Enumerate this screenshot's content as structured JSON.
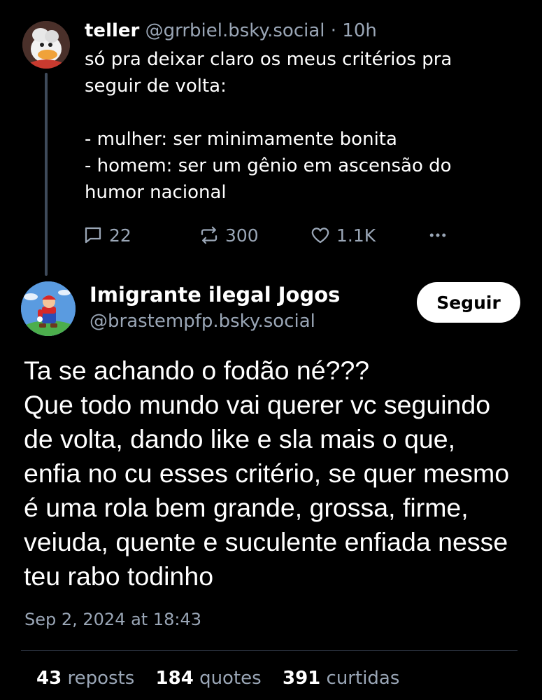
{
  "parent_post": {
    "display_name": "teller",
    "handle": "@grrbiel.bsky.social",
    "separator": "·",
    "time_ago": "10h",
    "text": "só pra deixar claro os meus critérios pra\nseguir de volta:\n\n- mulher: ser minimamente bonita\n- homem: ser um gênio em ascensão do\nhumor nacional",
    "avatar_icon": "duck-character-avatar",
    "actions": {
      "reply_count": "22",
      "repost_count": "300",
      "like_count": "1.1K",
      "reply_icon": "speech-bubble-icon",
      "repost_icon": "repost-arrows-icon",
      "like_icon": "heart-icon",
      "more_icon": "more-dots-icon"
    }
  },
  "main_post": {
    "display_name": "Imigrante ilegal Jogos",
    "handle": "@brastempfp.bsky.social",
    "avatar_icon": "mario-character-avatar",
    "follow_label": "Seguir",
    "text": "Ta se achando o fodão né???\nQue todo mundo vai querer vc seguindo\nde volta, dando like e sla mais o que,\nenfia no cu esses critério, se quer mesmo\né uma rola bem grande, grossa, firme,\nveiuda, quente e suculente enfiada nesse\nteu rabo todinho",
    "timestamp": "Sep 2, 2024 at 18:43",
    "stats": {
      "reposts_count": "43",
      "reposts_label": "reposts",
      "quotes_count": "184",
      "quotes_label": "quotes",
      "likes_count": "391",
      "likes_label": "curtidas"
    }
  },
  "colors": {
    "background": "#000000",
    "primary_text": "#ffffff",
    "secondary_text": "#9aa6b6",
    "thread_line": "#3e4a5a",
    "button_bg": "#ffffff"
  }
}
